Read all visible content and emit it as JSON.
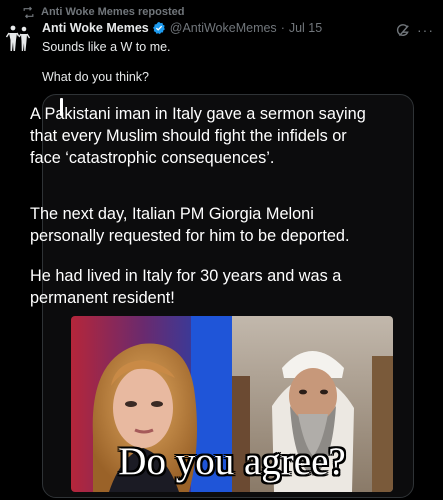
{
  "repost": {
    "icon": "repost-icon",
    "label": "Anti Woke Memes reposted"
  },
  "tweet": {
    "avatar_icon": "avatar-figures-icon",
    "display_name": "Anti Woke Memes",
    "verified_icon": "verified-badge-icon",
    "handle": "@AntiWokeMemes",
    "separator": "·",
    "date": "Jul 15",
    "grok_icon": "grok-icon",
    "more_icon": "more-icon",
    "more_label": "···",
    "text_line_1": "Sounds like a W to me.",
    "text_line_2": "What do you think?"
  },
  "media": {
    "paragraph_1": "A Pakistani iman in Italy gave a sermon saying that every Muslim should fight the infidels or face ‘catastrophic consequences’.",
    "paragraph_2": "The next day, Italian PM Giorgia Meloni personally requested for him to be deported.",
    "paragraph_3": "He had lived in Italy for 30 years and was a permanent resident!",
    "meme_caption": "Do you agree?"
  },
  "colors": {
    "background": "#000000",
    "text": "#e7e9ea",
    "muted": "#71767b",
    "verified": "#1d9bf0",
    "border": "#2f3336"
  }
}
